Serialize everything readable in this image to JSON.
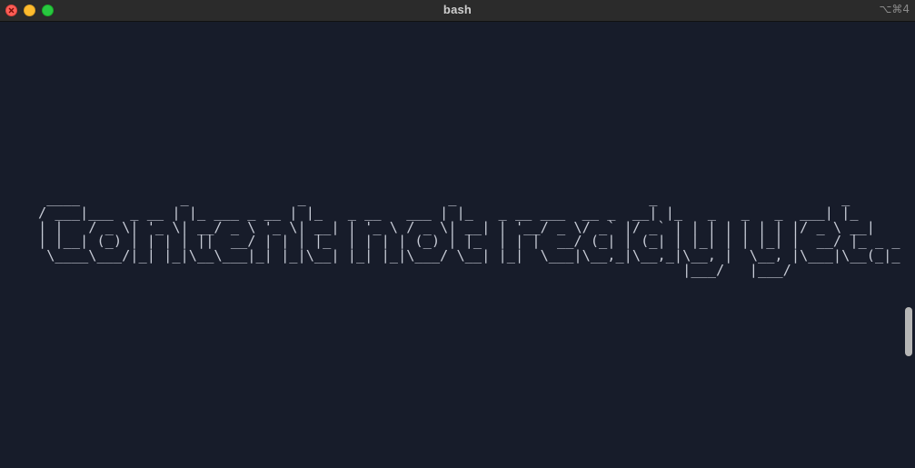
{
  "window": {
    "title": "bash",
    "shortcut": "⌥⌘4"
  },
  "terminal": {
    "banner_ascii": " ____            _             _                 _                       _                      _\n/ ___|___  _ __ | |_ ___ _ __ | |_   _ __   ___ | |_   _ __ ___  __ _  __| |_   _   _   _  ___| |_\n| |   / _ \\| '_ \\| __/ _ \\ '_ \\| __| | '_ \\ / _ \\| __| | '__/ _ \\/ _` |/ _` | | | | | | | |/ _ \\ __|\n| |__| (_) | | | | ||  __/ | | | |_  | | | | (_) | |_  | | |  __/ (_| | (_| | |_| | | |_| |  __/ |_ _ _ _\n \\____\\___/|_| |_|\\__\\___|_| |_|\\__| |_| |_|\\___/ \\__| |_|  \\___|\\__,_|\\__,_|\\__, |  \\__, |\\___|\\__(_|_|_)\n                                                                             |___/   |___/"
  },
  "colors": {
    "background": "#171c2a",
    "titlebar": "#2b2b2b",
    "text": "#c7cbd6"
  }
}
